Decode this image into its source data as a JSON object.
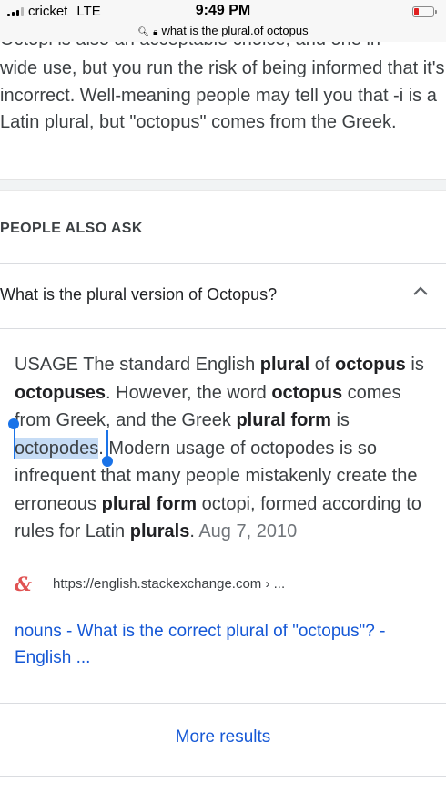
{
  "status_bar": {
    "carrier": "cricket",
    "network": "LTE",
    "time": "9:49 PM",
    "battery_color": "#e02020"
  },
  "address_bar": {
    "search_icon": "search-icon",
    "lock_icon": "lock-icon",
    "url": "what is the plural.of octopus"
  },
  "top_snippet": {
    "cut_line": "Octopi is also an acceptable choice, and one in",
    "text": "wide use, but you run the risk of being informed that it's incorrect. Well-meaning people may tell you that -i is a Latin plural, but \"octopus\" comes from the Greek."
  },
  "people_also_ask": {
    "heading": "PEOPLE ALSO ASK",
    "question": "What is the plural version of Octopus?",
    "chevron_icon": "chevron-up-icon",
    "answer": {
      "t1": "USAGE The standard English ",
      "b1": "plural",
      "t2": " of ",
      "b2": "octopus",
      "t3": " is ",
      "b3": "octopuses",
      "t4": ". However, the word ",
      "b4": "octopus",
      "t5": " comes from Greek, and the Greek ",
      "b5": "plural form",
      "t6": " is ",
      "selected": "octopodes",
      "t7": ". Modern usage of octopodes is so infrequent that many people mistakenly create the erroneous ",
      "b6": "plural form",
      "t8": " octopi, formed according to rules for Latin ",
      "b7": "plurals",
      "t9": ".  ",
      "date": "Aug 7, 2010"
    },
    "source": {
      "icon": "stackexchange-ampersand-icon",
      "url": "https://english.stackexchange.com › ..."
    },
    "result_link": "nouns - What is the correct plural of \"octopus\"? - English ..."
  },
  "more_results": "More results",
  "colors": {
    "link": "#1558d6",
    "selection": "#c6dcf5",
    "handle": "#1a73e8"
  }
}
